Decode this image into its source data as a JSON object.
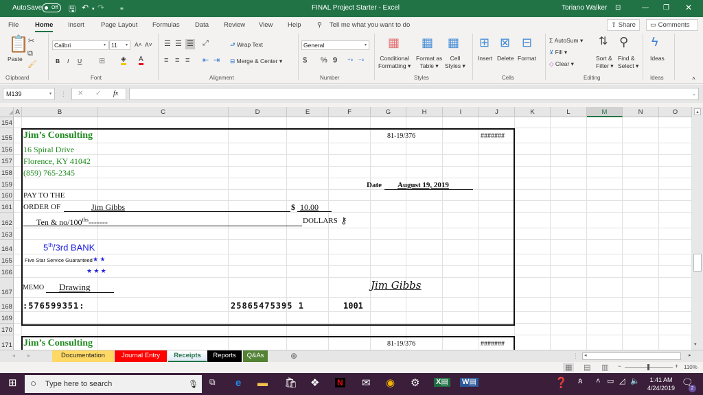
{
  "titlebar": {
    "autosave_label": "AutoSave",
    "autosave_state": "Off",
    "doc_title": "FINAL Project Starter  -  Excel",
    "user": "Toriano Walker"
  },
  "menu": {
    "items": [
      "File",
      "Home",
      "Insert",
      "Page Layout",
      "Formulas",
      "Data",
      "Review",
      "View",
      "Help"
    ],
    "active": "Home",
    "tell_me": "Tell me what you want to do",
    "share": "Share",
    "comments": "Comments"
  },
  "ribbon": {
    "clipboard": {
      "paste": "Paste",
      "label": "Clipboard"
    },
    "font": {
      "name": "Calibri",
      "size": "11",
      "bold": "B",
      "italic": "I",
      "underline": "U",
      "label": "Font",
      "highlight_color": "#f5c400",
      "font_color": "#e81123"
    },
    "alignment": {
      "wrap_text": "Wrap Text",
      "merge_center": "Merge & Center",
      "label": "Alignment"
    },
    "number": {
      "format": "General",
      "currency": "$",
      "percent": "%",
      "comma": "9",
      "label": "Number"
    },
    "styles": {
      "conditional": [
        "Conditional",
        "Formatting"
      ],
      "format_table": [
        "Format as",
        "Table"
      ],
      "cell_styles": [
        "Cell",
        "Styles"
      ],
      "label": "Styles"
    },
    "cells": {
      "insert": "Insert",
      "delete": "Delete",
      "format": "Format",
      "label": "Cells"
    },
    "editing": {
      "autosum": "AutoSum",
      "fill": "Fill",
      "clear": "Clear",
      "sort_filter": [
        "Sort &",
        "Filter"
      ],
      "find_select": [
        "Find &",
        "Select"
      ],
      "label": "Editing"
    },
    "ideas": {
      "button": "Ideas",
      "label": "Ideas"
    }
  },
  "formula_bar": {
    "name_box": "M139",
    "fx": "fx",
    "formula": ""
  },
  "columns": [
    "A",
    "B",
    "C",
    "D",
    "E",
    "F",
    "G",
    "H",
    "I",
    "J",
    "K",
    "L",
    "M",
    "N",
    "O"
  ],
  "selected_column": "M",
  "rows": [
    "154",
    "155",
    "156",
    "157",
    "158",
    "159",
    "160",
    "161",
    "162",
    "163",
    "164",
    "165",
    "166",
    "167",
    "168",
    "169",
    "170",
    "171"
  ],
  "check": {
    "company": "Jim’s Consulting",
    "address1": "16 Spiral Drive",
    "address2": "Florence, KY  41042",
    "phone": "(859) 765-2345",
    "routing_fraction": "81-19/376",
    "check_number_cell": "#######",
    "date_label": "Date",
    "date_value": "August 19, 2019",
    "pay_to_1": "PAY TO THE",
    "pay_to_2": "ORDER OF",
    "payee": "Jim Gibbs",
    "amount_symbol": "$",
    "amount": "10.00",
    "amount_words": "Ten & no/100",
    "amount_words_sup": "ths",
    "amount_dashes": "-------",
    "dollars": "DOLLARS",
    "bank_sup": "th",
    "bank_pre": "5",
    "bank_name": "/3rd BANK",
    "bank_slogan": "Five Star Service Guaranteed",
    "stars_row1": "★ ★",
    "stars_row2": "★ ★ ★",
    "memo_label": "MEMO",
    "memo_value": "Drawing",
    "signature": "Jim Gibbs",
    "micr_routing": ":576599351:",
    "micr_account": "25865475395 1",
    "micr_check": "1001"
  },
  "check2": {
    "company": "Jim’s Consulting",
    "routing_fraction": "81-19/376",
    "check_number_cell": "#######"
  },
  "sheets": [
    {
      "name": "Documentation",
      "color": "#ffd966",
      "text": "#222222"
    },
    {
      "name": "Journal Entry",
      "color": "#ff0000",
      "text": "#ffffff"
    },
    {
      "name": "Receipts",
      "color": "#ffffff",
      "text": "#217346",
      "active": true
    },
    {
      "name": "Reports",
      "color": "#000000",
      "text": "#ffffff"
    },
    {
      "name": "Q&As",
      "color": "#548235",
      "text": "#ffffff"
    }
  ],
  "status": {
    "zoom": "110%"
  },
  "taskbar": {
    "search_placeholder": "Type here to search",
    "time": "1:41 AM",
    "date": "4/24/2019",
    "notifications": "2"
  },
  "colors": {
    "excel_green": "#217346",
    "company_green": "#1e8a1e",
    "bank_blue": "#1f1fdd"
  }
}
